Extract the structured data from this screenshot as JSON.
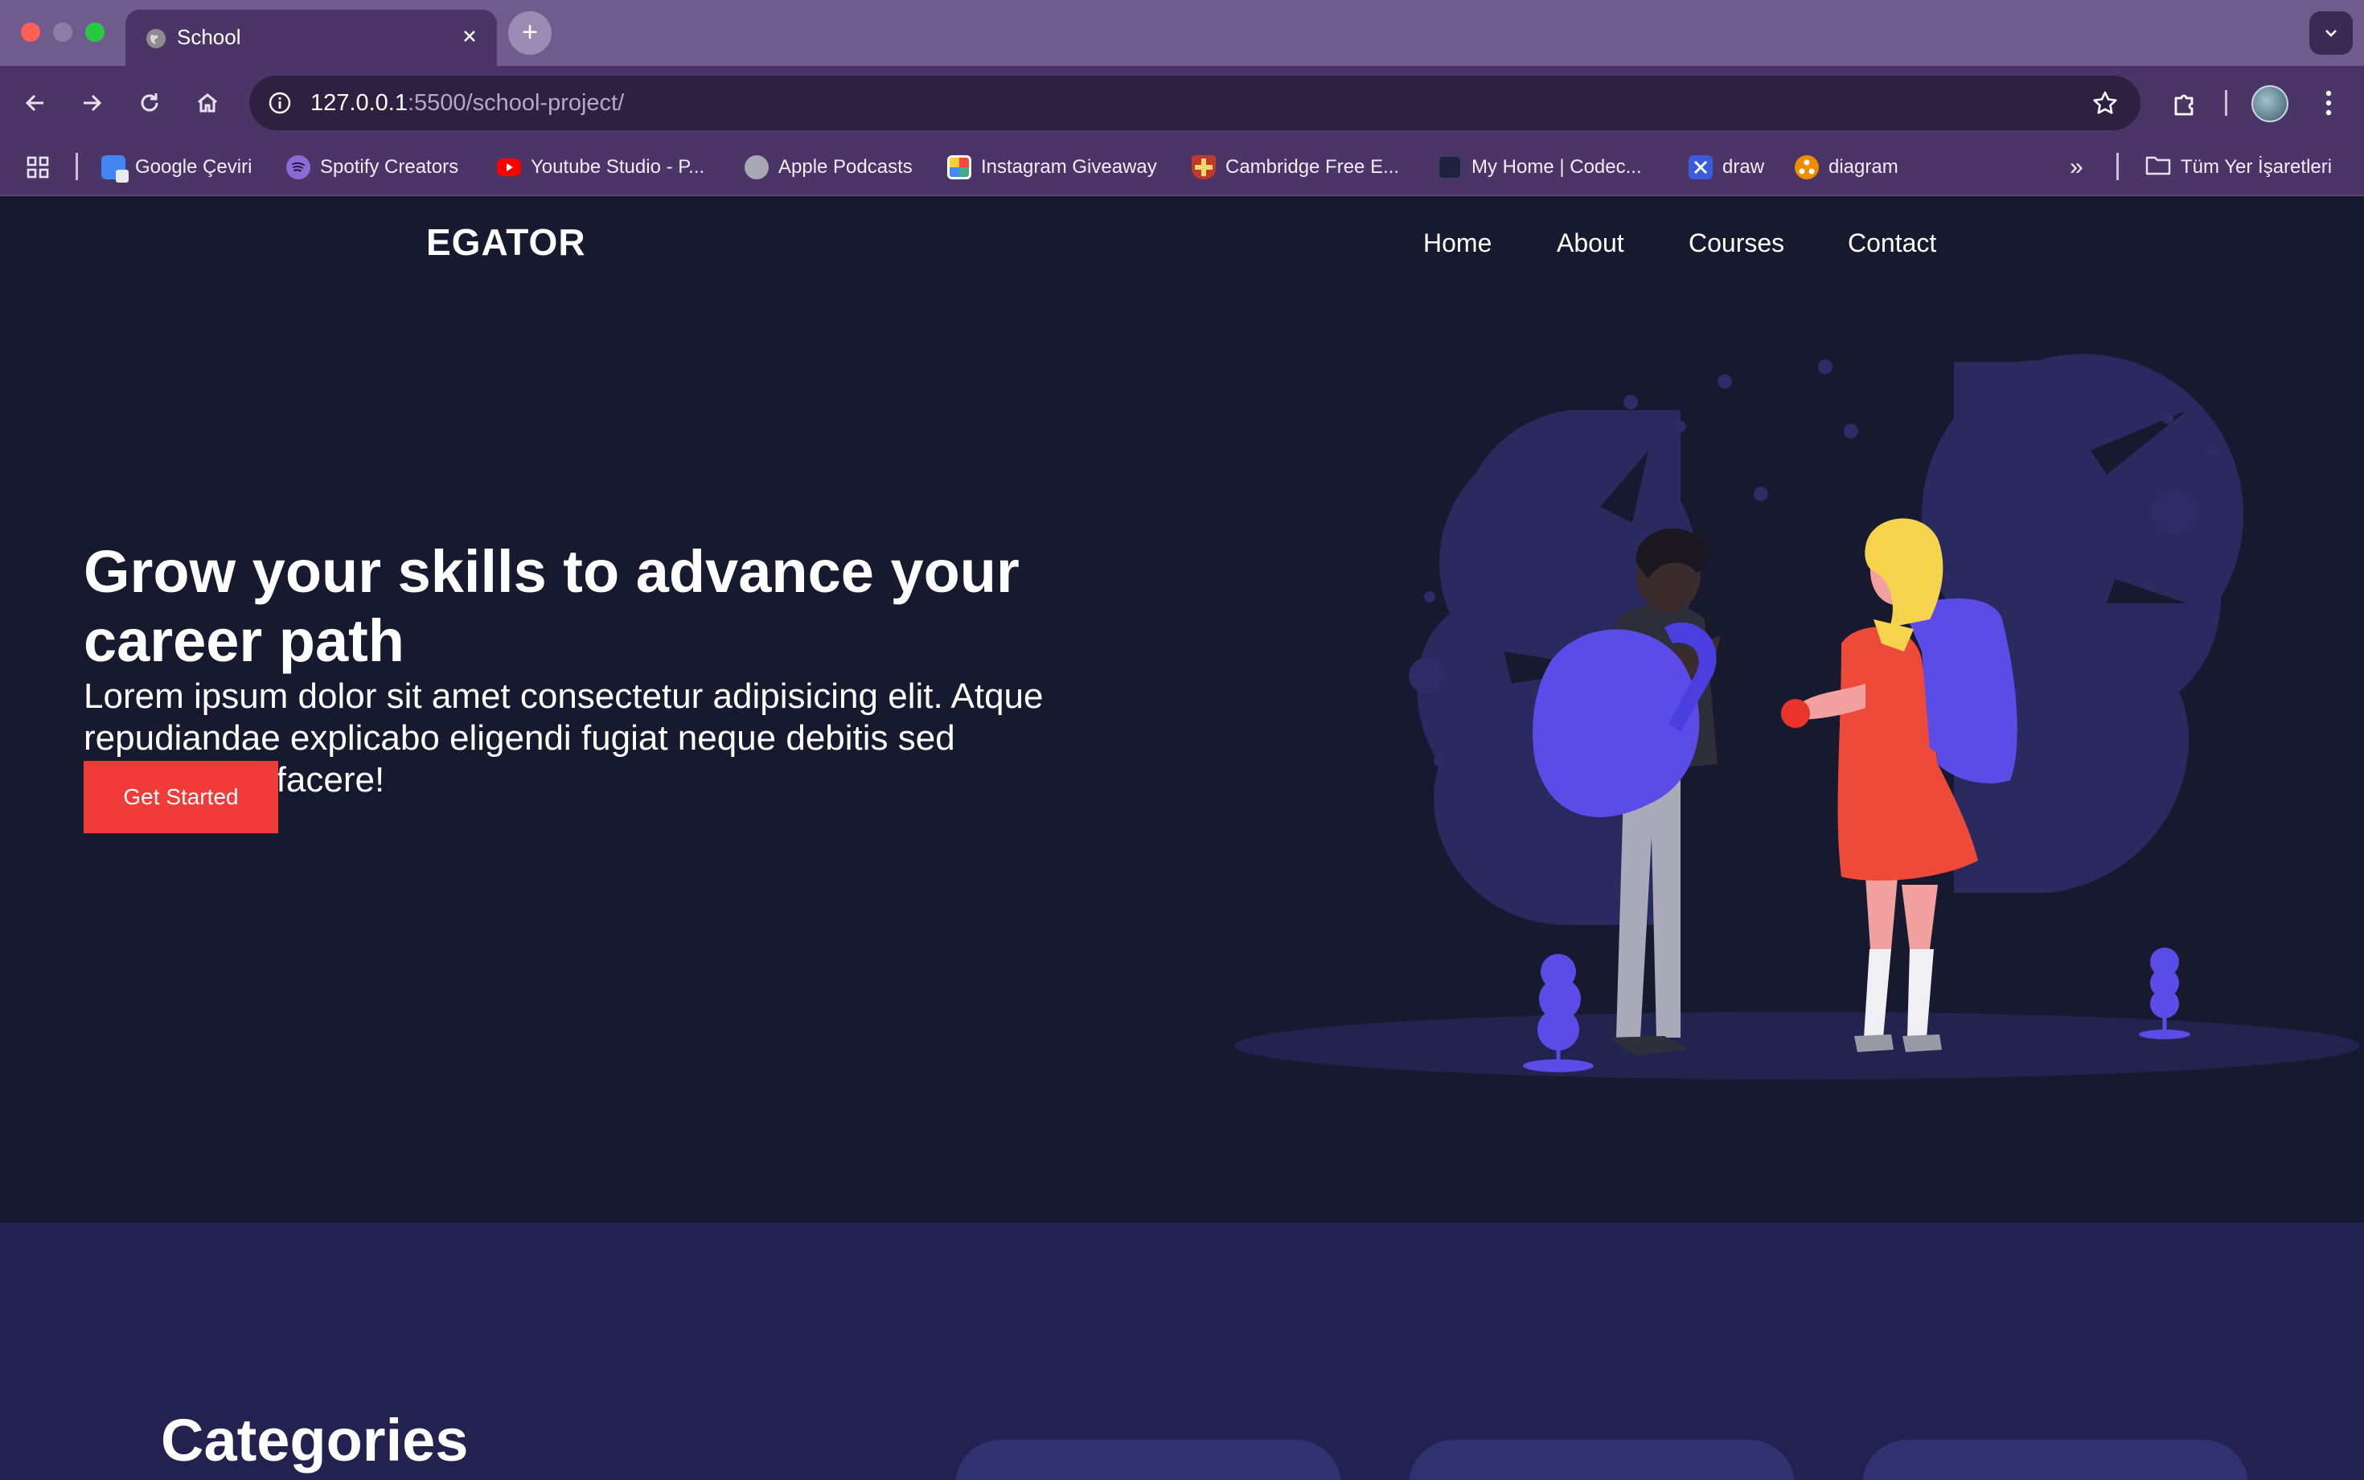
{
  "browser": {
    "tab_title": "School",
    "new_tab": "+",
    "url_host": "127.0.0.1",
    "url_path": ":5500/school-project/",
    "bookmarks": [
      {
        "label": "Google Çeviri",
        "icon": "google-translate-icon"
      },
      {
        "label": "Spotify Creators",
        "icon": "spotify-icon"
      },
      {
        "label": "Youtube Studio - P...",
        "icon": "youtube-icon"
      },
      {
        "label": "Apple Podcasts",
        "icon": "globe-icon"
      },
      {
        "label": "Instagram Giveaway",
        "icon": "instagram-giveaway-icon"
      },
      {
        "label": "Cambridge Free E...",
        "icon": "cambridge-icon"
      },
      {
        "label": "My Home | Codec...",
        "icon": "codecademy-icon"
      },
      {
        "label": "draw",
        "icon": "drawio-icon"
      },
      {
        "label": "diagram",
        "icon": "diagram-icon"
      }
    ],
    "more_bookmarks": "»",
    "all_bookmarks": "Tüm Yer İşaretleri"
  },
  "site": {
    "brand": "EGATOR",
    "nav": [
      "Home",
      "About",
      "Courses",
      "Contact"
    ],
    "hero": {
      "title": "Grow your skills to advance your career path",
      "text": "Lorem ipsum dolor sit amet consectetur adipisicing elit. Atque repudiandae explicabo eligendi fugiat neque debitis sed consectetur facere!",
      "cta": "Get Started"
    },
    "categories": {
      "title": "Categories"
    }
  },
  "colors": {
    "page_bg": "#171a2e",
    "categories_bg": "#22214f",
    "accent": "#f03b38",
    "illustration_primary": "#5b4ce8",
    "chrome_tab": "#4a3566"
  }
}
